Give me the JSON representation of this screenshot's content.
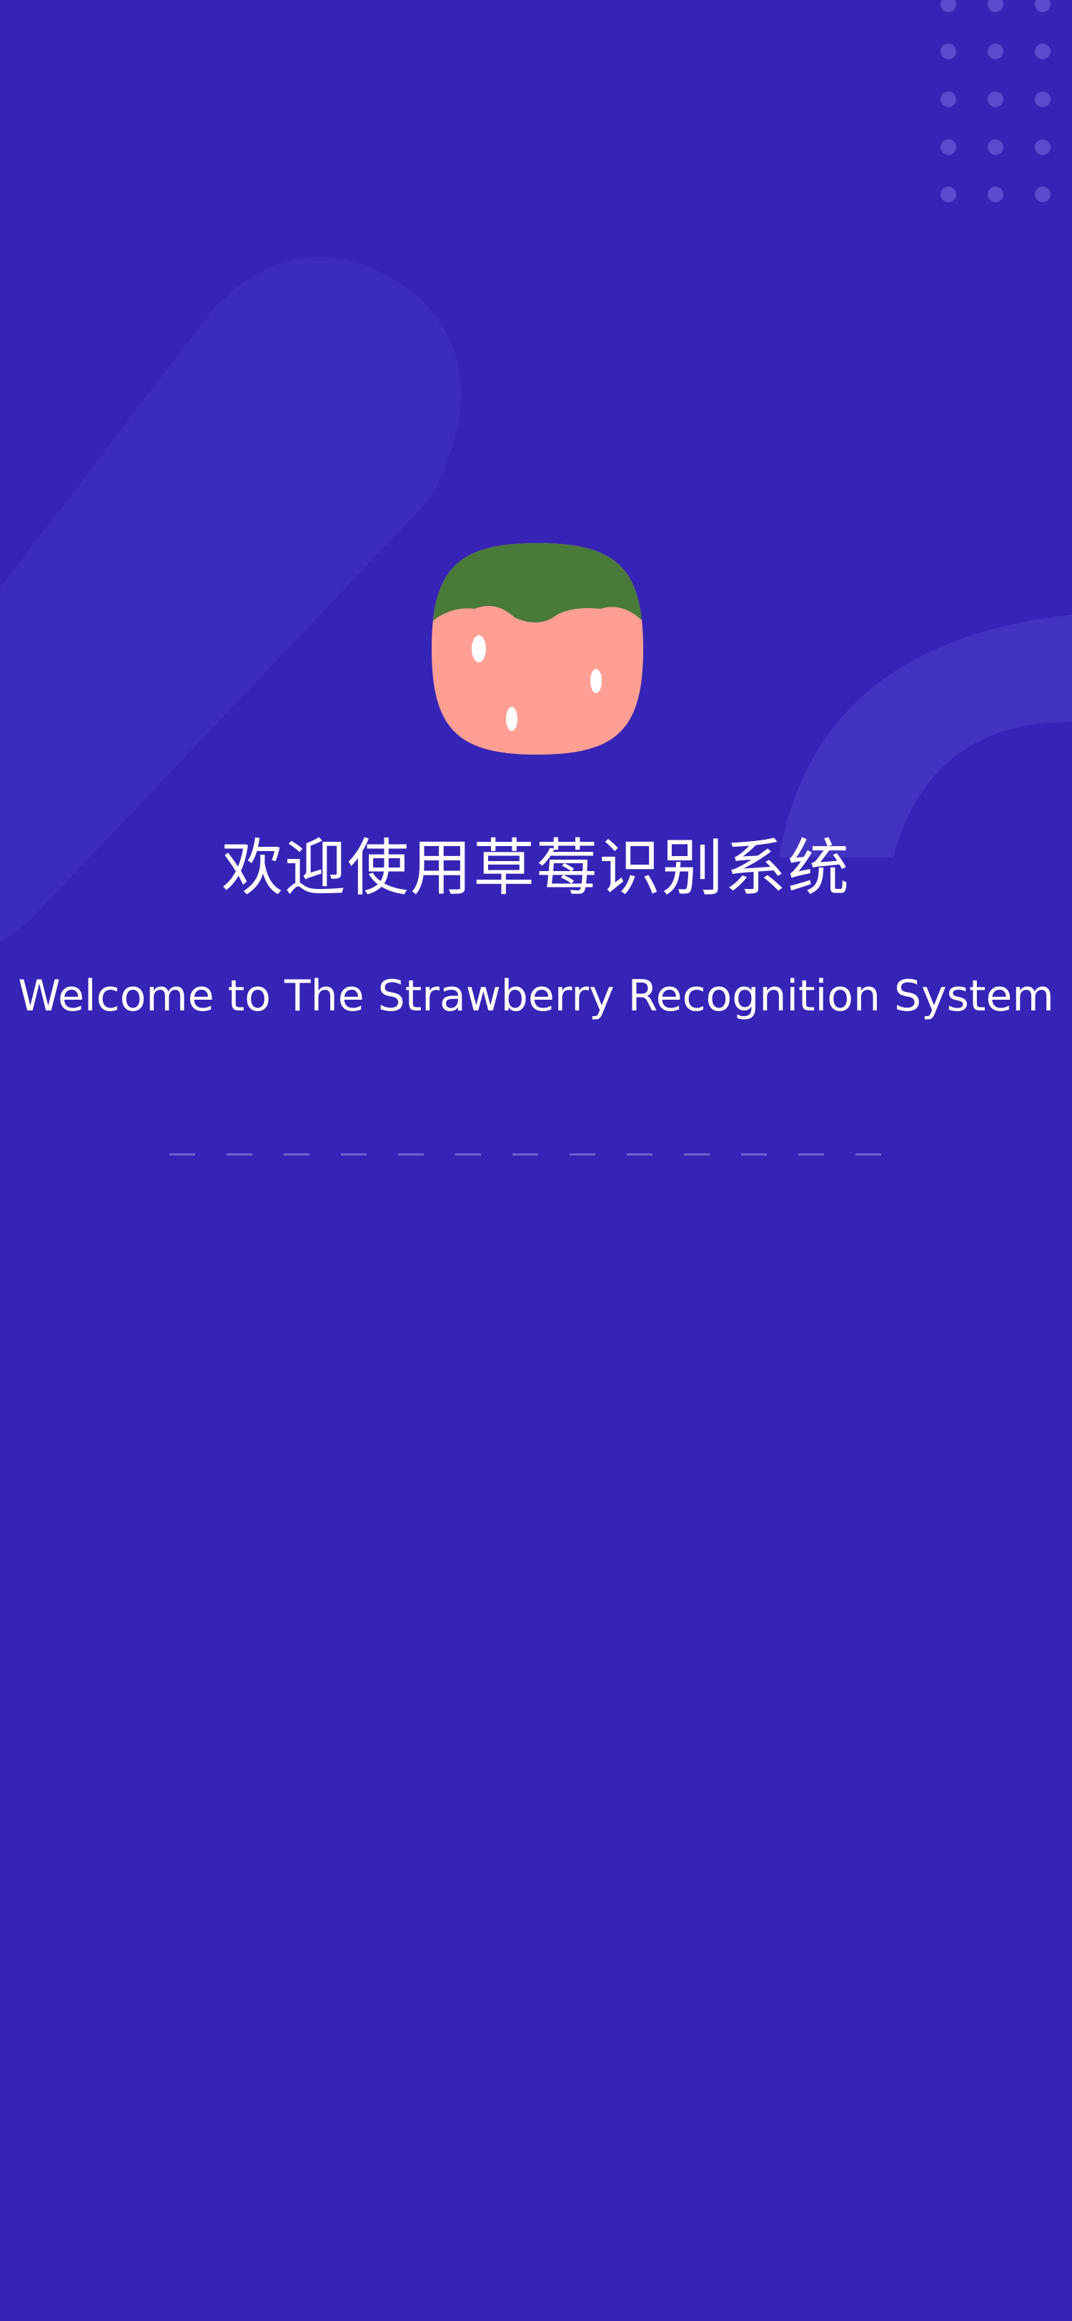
{
  "app": {
    "title_cn": "欢迎使用草莓识别系统",
    "title_en": "Welcome to The Strawberry Recognition System"
  },
  "colors": {
    "background": "#3524b6",
    "strawberry_body": "#ff9f94",
    "strawberry_leaf": "#4a7a3a",
    "seed": "#ffffff"
  },
  "icons": {
    "logo": "strawberry-icon",
    "decor": "dot-grid-decoration",
    "loader": "dashed-loading-indicator"
  }
}
